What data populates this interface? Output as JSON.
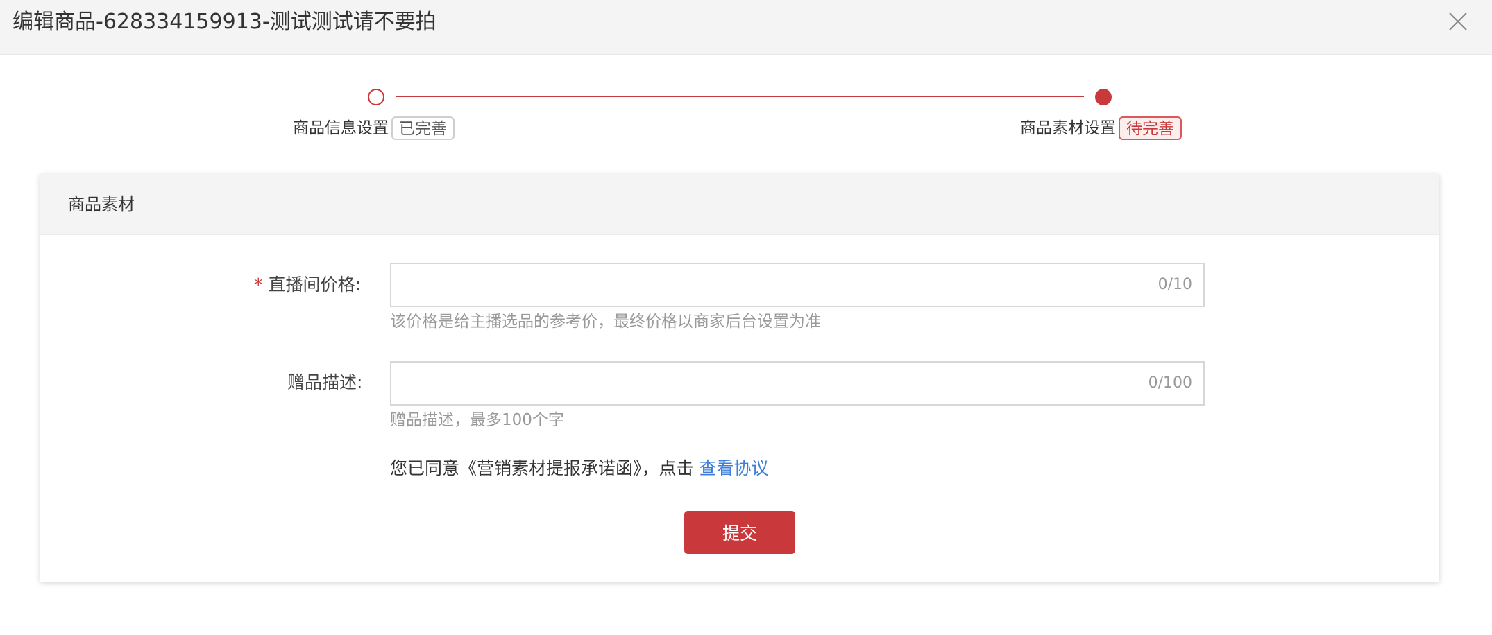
{
  "modal": {
    "title": "编辑商品-628334159913-测试测试请不要拍",
    "close_icon": "close-icon"
  },
  "steps": [
    {
      "label": "商品信息设置",
      "tag": "已完善",
      "state": "done"
    },
    {
      "label": "商品素材设置",
      "tag": "待完善",
      "state": "current"
    }
  ],
  "card": {
    "title": "商品素材"
  },
  "form": {
    "price": {
      "required_mark": "*",
      "label": "直播间价格:",
      "value": "",
      "counter": "0/10",
      "hint": "该价格是给主播选品的参考价，最终价格以商家后台设置为准"
    },
    "gift": {
      "label": "赠品描述:",
      "value": "",
      "counter": "0/100",
      "hint": "赠品描述，最多100个字"
    },
    "agreement": {
      "text": "您已同意《营销素材提报承诺函》，点击 ",
      "link": "查看协议"
    },
    "submit_label": "提交"
  },
  "colors": {
    "accent": "#c9393c",
    "link": "#3f7fd9",
    "header_bg": "#f4f4f5"
  }
}
